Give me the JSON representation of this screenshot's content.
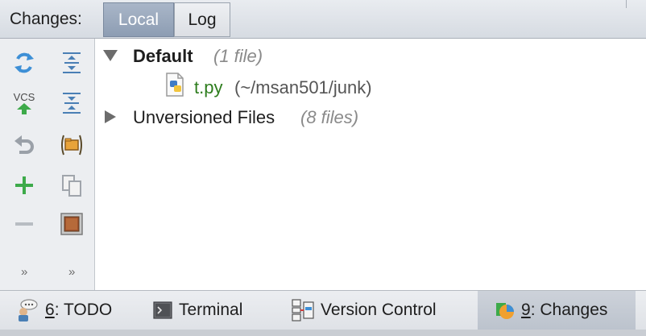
{
  "header": {
    "title": "Changes:",
    "tabs": [
      {
        "label": "Local",
        "active": true
      },
      {
        "label": "Log",
        "active": false
      }
    ]
  },
  "toolbar": {
    "buttons": [
      "refresh-icon",
      "expand-all-icon",
      "vcs-commit-icon",
      "collapse-all-icon",
      "rollback-icon",
      "group-by-directory-icon",
      "add-changelist-icon",
      "copy-icon",
      "remove-changelist-icon",
      "show-diff-icon"
    ],
    "vcs_label": "VCS",
    "more_left": "»",
    "more_right": "»"
  },
  "tree": {
    "default_changelist": {
      "name": "Default",
      "count": "(1 file)",
      "expanded": true
    },
    "file": {
      "name": "t.py",
      "path": "(~/msan501/junk)",
      "icon": "python-file-icon"
    },
    "unversioned": {
      "name": "Unversioned Files",
      "count": "(8 files)",
      "expanded": false
    }
  },
  "bottom_tabs": [
    {
      "number": "6",
      "label": ": TODO",
      "icon": "todo-icon",
      "active": false
    },
    {
      "number": "",
      "label": "Terminal",
      "icon": "terminal-icon",
      "active": false
    },
    {
      "number": "",
      "label": "Version Control",
      "icon": "version-control-icon",
      "active": false
    },
    {
      "number": "9",
      "label": ": Changes",
      "icon": "changes-icon",
      "active": true
    }
  ],
  "colors": {
    "accent_tab": "#9aa8bd",
    "file_name_green": "#2e7d1e",
    "vcs_arrow_green": "#3daa4a",
    "add_green": "#3daa4a",
    "refresh_blue": "#3d8fd6"
  }
}
